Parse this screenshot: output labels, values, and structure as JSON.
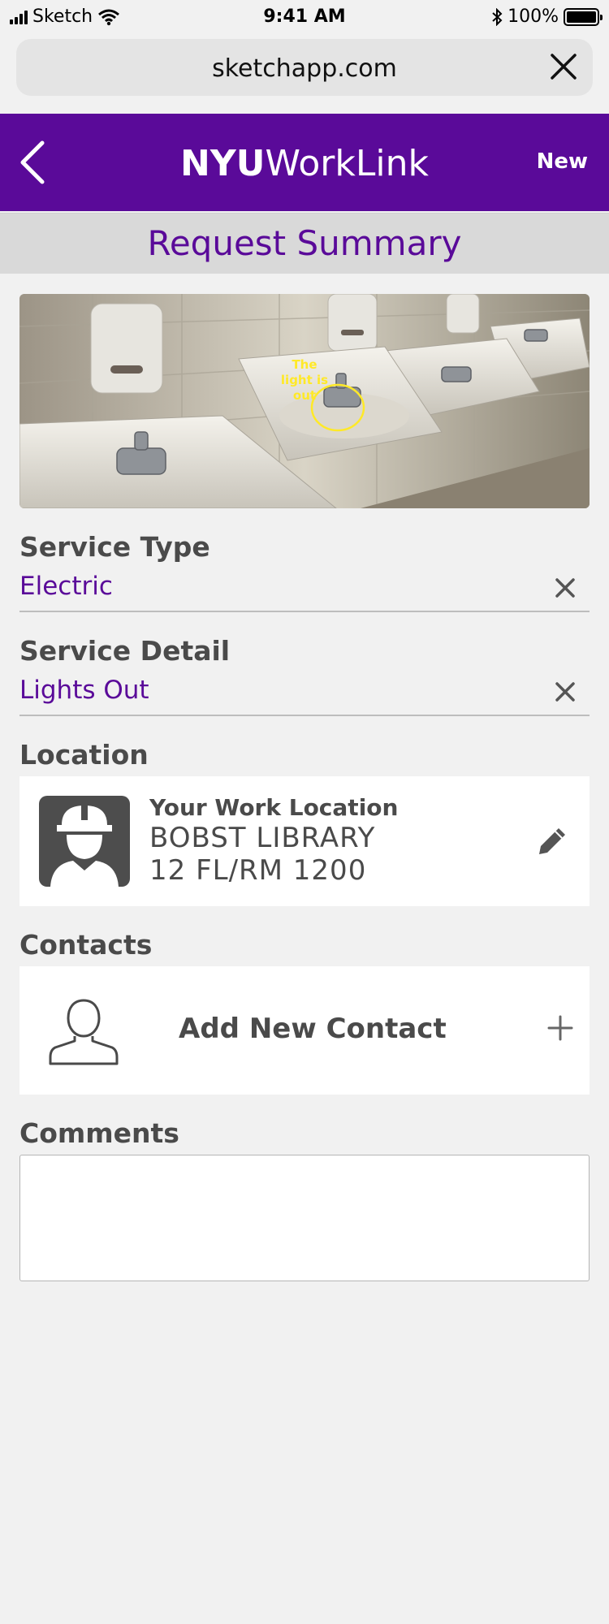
{
  "status_bar": {
    "carrier": "Sketch",
    "time": "9:41 AM",
    "battery": "100%"
  },
  "browser": {
    "url": "sketchapp.com"
  },
  "header": {
    "brand_bold": "NYU",
    "brand_rest": "WorkLink",
    "new_label": "New"
  },
  "page": {
    "title": "Request Summary"
  },
  "photo": {
    "caption": "The light is out"
  },
  "service_type": {
    "label": "Service Type",
    "value": "Electric"
  },
  "service_detail": {
    "label": "Service Detail",
    "value": "Lights Out"
  },
  "location": {
    "label": "Location",
    "card_title": "Your Work Location",
    "building": "BOBST LIBRARY",
    "room": "12 FL/RM 1200"
  },
  "contacts": {
    "label": "Contacts",
    "add_label": "Add New Contact"
  },
  "comments": {
    "label": "Comments",
    "value": ""
  },
  "colors": {
    "brand_purple": "#5a0a99",
    "label_gray": "#4a4a4a"
  }
}
